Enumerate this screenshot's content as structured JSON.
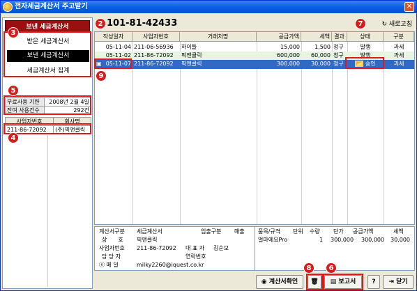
{
  "window": {
    "title": "전자세금계산서 주고받기",
    "close": "✕"
  },
  "sidebar": {
    "header": "보낸 세금계산서",
    "items": [
      "받은 세금계산서",
      "보낸 세금계산서",
      "세금계산서 집계"
    ],
    "free_use_label": "무료사용 기한",
    "free_use_value": "2008년 2월 4일",
    "remain_label": "잔여 사용건수",
    "remain_value": "292건",
    "biz_col": "사업자번호",
    "company_col": "회사명",
    "biz_no": "211-86-72092",
    "company": "(주)픽앤클릭"
  },
  "header": {
    "biz_number": "101-81-42433",
    "refresh": "새로고침"
  },
  "table": {
    "columns": [
      "작성일자",
      "사업자번호",
      "거래처명",
      "공급가액",
      "세액",
      "결과",
      "상태",
      "구분"
    ],
    "rows": [
      {
        "date": "05-11-04",
        "biz": "211-06-56936",
        "name": "하이들",
        "supply": "15,000",
        "tax": "1,500",
        "result": "청구",
        "status": "발행",
        "kind": "과세"
      },
      {
        "date": "05-11-02",
        "biz": "211-86-72092",
        "name": "픽앤클릭",
        "supply": "600,000",
        "tax": "60,000",
        "result": "청구",
        "status": "발행",
        "kind": "과세"
      },
      {
        "date": "05-11-07",
        "biz": "211-86-72092",
        "name": "픽앤클릭",
        "supply": "300,000",
        "tax": "30,000",
        "result": "청구",
        "status": "승인",
        "kind": "과세"
      }
    ]
  },
  "detail": {
    "calc_type_label": "계산서구분",
    "calc_type": "세금계산서",
    "io_label": "입출구분",
    "io": "매출",
    "trade_label": "상　　호",
    "trade": "픽앤클릭",
    "biz_label": "사업자번호",
    "biz": "211-86-72092",
    "rep_label": "대 표 자",
    "rep": "김순모",
    "manager_label": "담 당 자",
    "contact_label": "연락번호",
    "email_label": "ⓔ 메 일",
    "email": "milky2260@iquest.co.kr"
  },
  "items": {
    "columns": [
      "품목/규격",
      "단위",
      "수량",
      "단가",
      "공급가액",
      "세액"
    ],
    "row": {
      "name": "얼마에요Pro",
      "unit": "",
      "qty": "1",
      "price": "300,000",
      "supply": "300,000",
      "tax": "30,000"
    }
  },
  "buttons": {
    "confirm": "계산서확인",
    "report": "보고서",
    "close": "닫기",
    "help": "?"
  },
  "badges": [
    "2",
    "3",
    "4",
    "5",
    "6",
    "7",
    "8",
    "9"
  ]
}
